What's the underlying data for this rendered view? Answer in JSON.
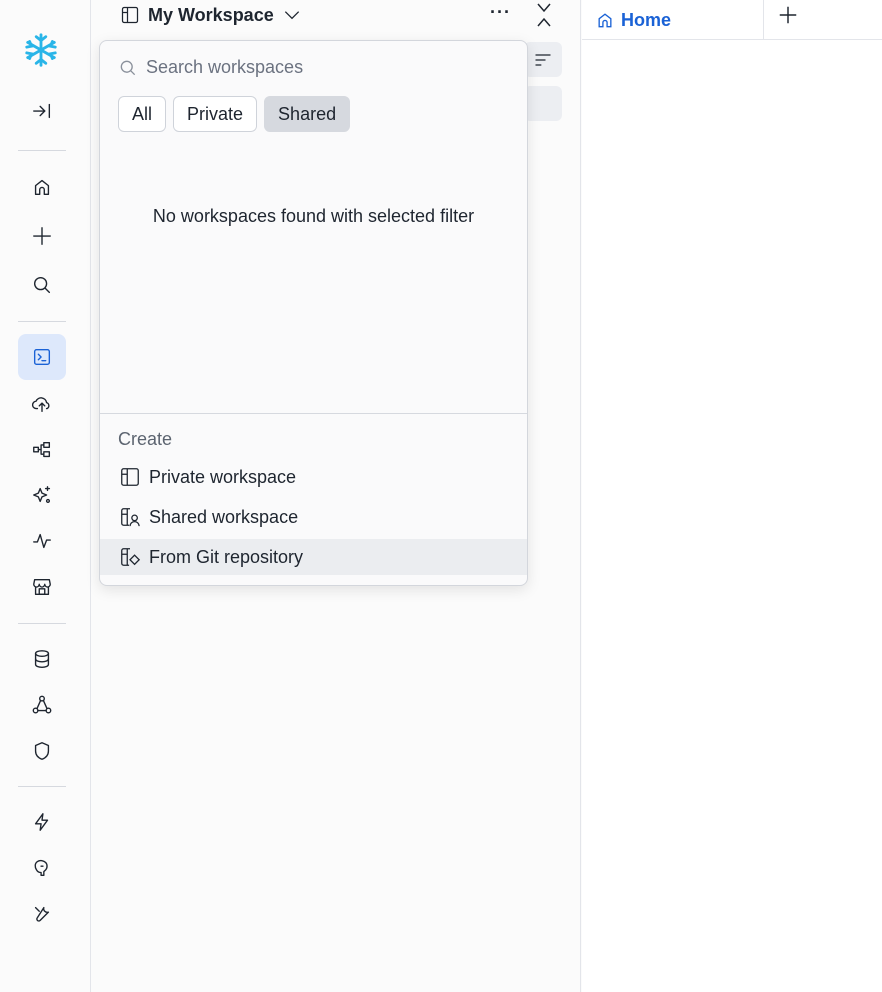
{
  "rail": {
    "logo": "snowflake-logo",
    "items": [
      {
        "name": "expand-nav-icon"
      },
      {
        "name": "home-icon"
      },
      {
        "name": "create-icon"
      },
      {
        "name": "search-icon"
      },
      {
        "name": "projects-icon"
      },
      {
        "name": "data-upload-icon"
      },
      {
        "name": "transformation-icon"
      },
      {
        "name": "ai-ml-icon"
      },
      {
        "name": "monitoring-icon"
      },
      {
        "name": "marketplace-icon"
      },
      {
        "name": "catalog-icon"
      },
      {
        "name": "horizon-icon"
      },
      {
        "name": "governance-icon"
      },
      {
        "name": "compute-icon"
      },
      {
        "name": "postgres-icon"
      },
      {
        "name": "admin-icon"
      }
    ]
  },
  "workspace": {
    "title": "My Workspace",
    "more": "···"
  },
  "dropdown": {
    "search_placeholder": "Search workspaces",
    "filters": [
      "All",
      "Private",
      "Shared"
    ],
    "selected_filter": "Shared",
    "empty_message": "No workspaces found with selected filter",
    "create_label": "Create",
    "create_items": [
      "Private workspace",
      "Shared workspace",
      "From Git repository"
    ]
  },
  "tabs": {
    "home_label": "Home"
  },
  "colors": {
    "accent": "#1a62d6",
    "active_bg": "#dde8fb",
    "logo": "#29b5e8"
  }
}
